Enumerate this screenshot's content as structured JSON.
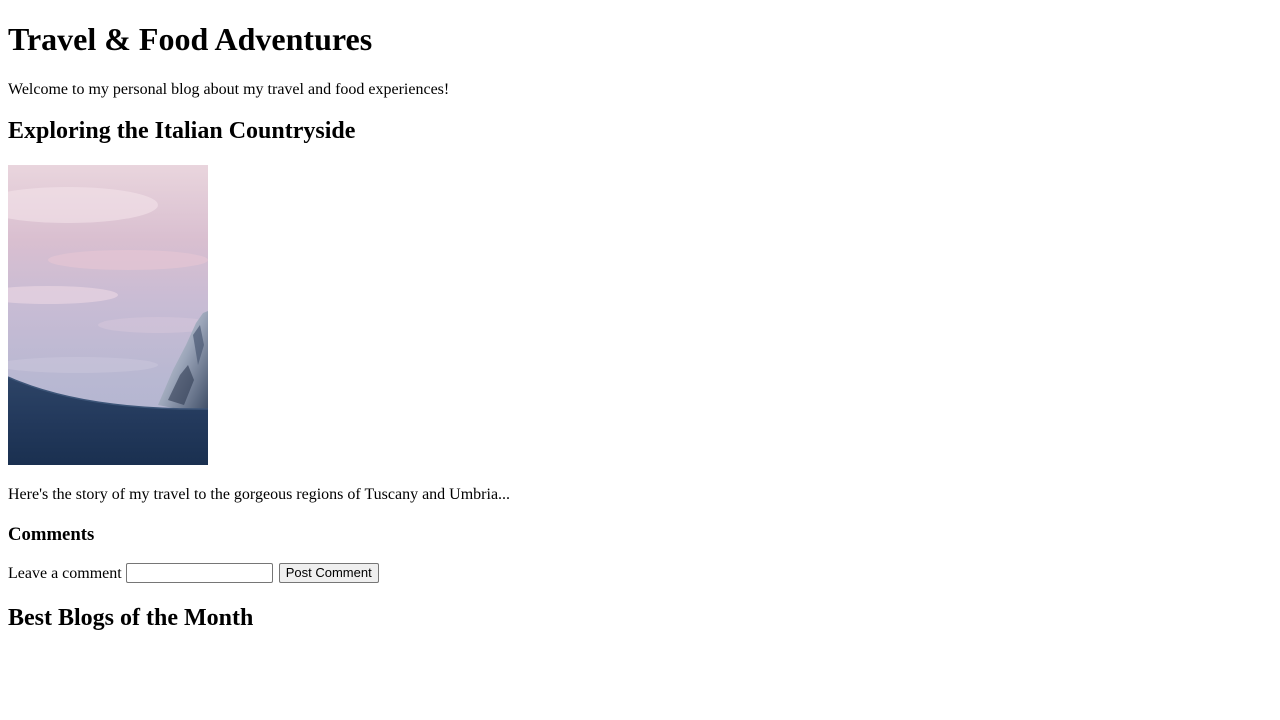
{
  "header": {
    "title": "Travel & Food Adventures",
    "intro": "Welcome to my personal blog about my travel and food experiences!"
  },
  "post": {
    "title": "Exploring the Italian Countryside",
    "image_subject": "snowy mountain peak under pink sunset sky",
    "excerpt": "Here's the story of my travel to the gorgeous regions of Tuscany and Umbria..."
  },
  "comments": {
    "heading": "Comments",
    "label": "Leave a comment",
    "input_value": "",
    "button_label": "Post Comment"
  },
  "best_blogs": {
    "heading": "Best Blogs of the Month"
  },
  "colors": {
    "text": "#000000",
    "background": "#ffffff",
    "button_bg": "#efefef",
    "border": "#767676"
  }
}
